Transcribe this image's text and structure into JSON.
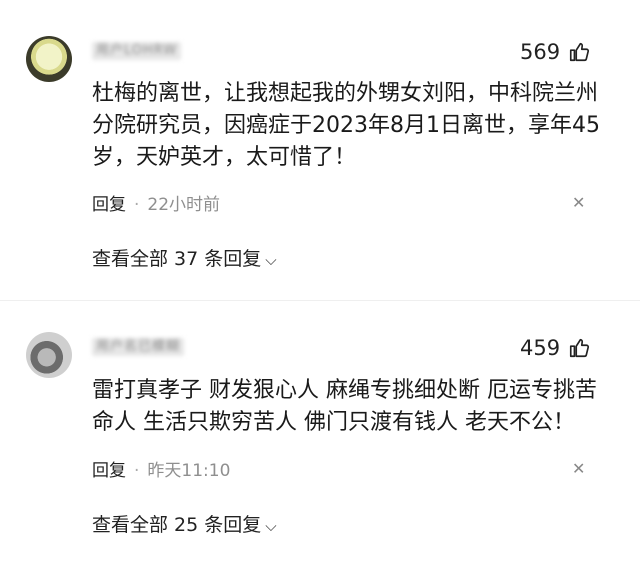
{
  "comments": [
    {
      "username": "用户LOHRW",
      "likes": "569",
      "text": "杜梅的离世，让我想起我的外甥女刘阳，中科院兰州分院研究员，因癌症于2023年8月1日离世，享年45岁，天妒英才，太可惜了！",
      "reply_label": "回复",
      "time": "22小时前",
      "view_replies": "查看全部 37 条回复"
    },
    {
      "username": "用户名已模糊",
      "likes": "459",
      "text": "雷打真孝子 财发狠心人 麻绳专挑细处断 厄运专挑苦命人 生活只欺穷苦人 佛门只渡有钱人 老天不公！",
      "reply_label": "回复",
      "time": "昨天11:10",
      "view_replies": "查看全部 25 条回复"
    }
  ],
  "icons": {
    "like": "thumbs-up-icon",
    "dismiss": "close-icon",
    "expand": "chevron-down-icon"
  }
}
